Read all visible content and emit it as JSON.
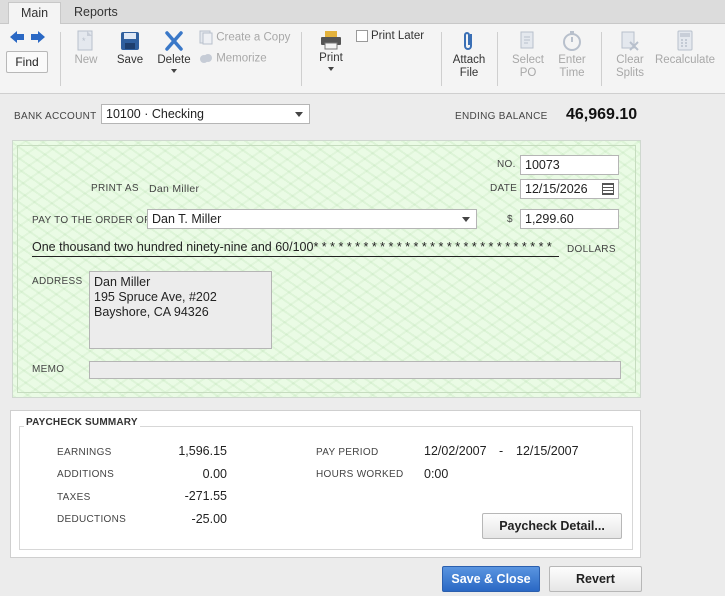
{
  "tabs": [
    {
      "label": "Main"
    },
    {
      "label": "Reports"
    }
  ],
  "toolbar": {
    "find": "Find",
    "new": "New",
    "save": "Save",
    "delete": "Delete",
    "create_copy": "Create a Copy",
    "memorize": "Memorize",
    "print": "Print",
    "print_later": "Print Later",
    "attach_1": "Attach",
    "attach_2": "File",
    "select_1": "Select",
    "select_2": "PO",
    "enter_1": "Enter",
    "enter_2": "Time",
    "clear_1": "Clear",
    "clear_2": "Splits",
    "recalculate": "Recalculate"
  },
  "bank": {
    "label_bank": "BANK",
    "label_account": "ACCOUNT",
    "account_value": "10100 · Checking",
    "ending_balance_label": "ENDING BALANCE",
    "ending_balance": "46,969.10"
  },
  "check": {
    "no_label": "NO.",
    "no_value": "10073",
    "date_label": "DATE",
    "date_value": "12/15/2026",
    "print_as_label": "PRINT AS",
    "print_as_value": "Dan Miller",
    "pay_to_label": "PAY TO THE ORDER OF",
    "payee": "Dan T. Miller",
    "currency_symbol": "$",
    "amount": "1,299.60",
    "amount_words": "One thousand two hundred ninety-nine and 60/100* * * * * * * * * * * * * * * * * * * * * * * * * * * * *",
    "dollars_label": "DOLLARS",
    "address_label": "ADDRESS",
    "address_lines": [
      "Dan Miller",
      "195 Spruce Ave, #202",
      "Bayshore, CA 94326"
    ],
    "memo_label": "MEMO",
    "memo_value": ""
  },
  "summary": {
    "title": "PAYCHECK SUMMARY",
    "earnings_label": "EARNINGS",
    "earnings": "1,596.15",
    "additions_label": "ADDITIONS",
    "additions": "0.00",
    "taxes_label": "TAXES",
    "taxes": "-271.55",
    "deductions_label": "DEDUCTIONS",
    "deductions": "-25.00",
    "pay_period_label": "PAY PERIOD",
    "pay_period_start": "12/02/2007",
    "pay_period_dash": "-",
    "pay_period_end": "12/15/2007",
    "hours_worked_label": "HOURS WORKED",
    "hours_worked": "0:00",
    "detail_button": "Paycheck Detail..."
  },
  "footer": {
    "save_close": "Save & Close",
    "revert": "Revert"
  },
  "colors": {
    "check_background": "#eafbe5",
    "primary_button": "#2a68c4"
  }
}
